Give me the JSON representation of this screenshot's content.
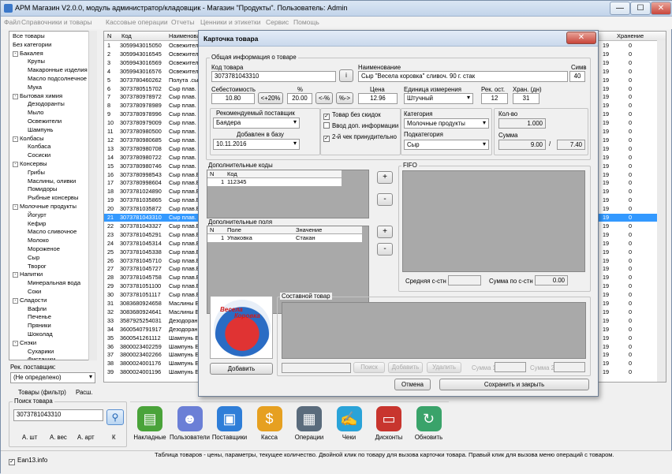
{
  "window": {
    "title": "АРМ Магазин V2.0.0, модуль администратор/кладовщик - Магазин \"Продукты\". Пользователь: Admin",
    "min": "—",
    "max": "☐",
    "close": "✕"
  },
  "menu": [
    "Файл",
    "Справочники и товары",
    "Кассовые операции",
    "Отчеты",
    "Ценники и этикетки",
    "Сервис",
    "Помощь"
  ],
  "tree": [
    {
      "label": "Все товары",
      "lvl": 0,
      "exp": ""
    },
    {
      "label": "Без категории",
      "lvl": 0,
      "exp": ""
    },
    {
      "label": "Бакалея",
      "lvl": 0,
      "exp": "-"
    },
    {
      "label": "Крупы",
      "lvl": 1,
      "exp": ""
    },
    {
      "label": "Макаронные изделия",
      "lvl": 1,
      "exp": ""
    },
    {
      "label": "Масло подсолнечное",
      "lvl": 1,
      "exp": ""
    },
    {
      "label": "Мука",
      "lvl": 1,
      "exp": ""
    },
    {
      "label": "Бытовая химия",
      "lvl": 0,
      "exp": "-"
    },
    {
      "label": "Дезодоранты",
      "lvl": 1,
      "exp": ""
    },
    {
      "label": "Мыло",
      "lvl": 1,
      "exp": ""
    },
    {
      "label": "Освежители",
      "lvl": 1,
      "exp": ""
    },
    {
      "label": "Шампунь",
      "lvl": 1,
      "exp": ""
    },
    {
      "label": "Колбасы",
      "lvl": 0,
      "exp": "-"
    },
    {
      "label": "Колбаса",
      "lvl": 1,
      "exp": ""
    },
    {
      "label": "Сосиски",
      "lvl": 1,
      "exp": ""
    },
    {
      "label": "Консервы",
      "lvl": 0,
      "exp": "-"
    },
    {
      "label": "Грибы",
      "lvl": 1,
      "exp": ""
    },
    {
      "label": "Маслины, оливки",
      "lvl": 1,
      "exp": ""
    },
    {
      "label": "Помидоры",
      "lvl": 1,
      "exp": ""
    },
    {
      "label": "Рыбные консервы",
      "lvl": 1,
      "exp": ""
    },
    {
      "label": "Молочные продукты",
      "lvl": 0,
      "exp": "-"
    },
    {
      "label": "Йогурт",
      "lvl": 1,
      "exp": ""
    },
    {
      "label": "Кефир",
      "lvl": 1,
      "exp": ""
    },
    {
      "label": "Масло сливочное",
      "lvl": 1,
      "exp": ""
    },
    {
      "label": "Молоко",
      "lvl": 1,
      "exp": ""
    },
    {
      "label": "Мороженое",
      "lvl": 1,
      "exp": ""
    },
    {
      "label": "Сыр",
      "lvl": 1,
      "exp": ""
    },
    {
      "label": "Творог",
      "lvl": 1,
      "exp": ""
    },
    {
      "label": "Напитки",
      "lvl": 0,
      "exp": "-"
    },
    {
      "label": "Минеральная вода",
      "lvl": 1,
      "exp": ""
    },
    {
      "label": "Соки",
      "lvl": 1,
      "exp": ""
    },
    {
      "label": "Сладости",
      "lvl": 0,
      "exp": "-"
    },
    {
      "label": "Вафли",
      "lvl": 1,
      "exp": ""
    },
    {
      "label": "Печенье",
      "lvl": 1,
      "exp": ""
    },
    {
      "label": "Пряники",
      "lvl": 1,
      "exp": ""
    },
    {
      "label": "Шоколад",
      "lvl": 1,
      "exp": ""
    },
    {
      "label": "Снэки",
      "lvl": 0,
      "exp": "-"
    },
    {
      "label": "Сухарики",
      "lvl": 1,
      "exp": ""
    },
    {
      "label": "Фисташки",
      "lvl": 1,
      "exp": ""
    }
  ],
  "left": {
    "supplier_label": "Рек. поставщик:",
    "supplier_value": "(Не определено)",
    "tab1": "Товары (фильтр)",
    "tab2": "Расш.",
    "search_group": "Поиск товара",
    "search_value": "3073781043310",
    "opt1": "А. шт",
    "opt2": "А. вес",
    "opt3": "А. арт",
    "opt4": "К",
    "ean": "Ean13.info"
  },
  "grid": {
    "headers": {
      "n": "N",
      "code": "Код",
      "name": "Наименование",
      "storage": "Хранение"
    },
    "rows": [
      {
        "n": "1",
        "code": "3059943015050",
        "name": "Освежител",
        "a": "19",
        "b": "0"
      },
      {
        "n": "2",
        "code": "3059943016545",
        "name": "Освежител",
        "a": "19",
        "b": "0"
      },
      {
        "n": "3",
        "code": "3059943016569",
        "name": "Освежител",
        "a": "19",
        "b": "0"
      },
      {
        "n": "4",
        "code": "3059943016576",
        "name": "Освежител",
        "a": "19",
        "b": "0"
      },
      {
        "n": "5",
        "code": "3073780460262",
        "name": "Полута .сы",
        "a": "19",
        "b": "0"
      },
      {
        "n": "6",
        "code": "3073780515702",
        "name": "Сыр плав.",
        "a": "19",
        "b": "0"
      },
      {
        "n": "7",
        "code": "3073780978972",
        "name": "Сыр плав.",
        "a": "19",
        "b": "0"
      },
      {
        "n": "8",
        "code": "3073780978989",
        "name": "Сыр плав.",
        "a": "19",
        "b": "0"
      },
      {
        "n": "9",
        "code": "3073780978996",
        "name": "Сыр плав.",
        "a": "19",
        "b": "0"
      },
      {
        "n": "10",
        "code": "3073780979009",
        "name": "Сыр плав.",
        "a": "19",
        "b": "0"
      },
      {
        "n": "11",
        "code": "3073780980500",
        "name": "Сыр плав.",
        "a": "19",
        "b": "0"
      },
      {
        "n": "12",
        "code": "3073780980685",
        "name": "Сыр плав.",
        "a": "19",
        "b": "0"
      },
      {
        "n": "13",
        "code": "3073780980708",
        "name": "Сыр плав.",
        "a": "19",
        "b": "0"
      },
      {
        "n": "14",
        "code": "3073780980722",
        "name": "Сыр плав.",
        "a": "19",
        "b": "0"
      },
      {
        "n": "15",
        "code": "3073780980746",
        "name": "Сыр плав.",
        "a": "19",
        "b": "0"
      },
      {
        "n": "16",
        "code": "3073780998543",
        "name": "Сыр плав.Е",
        "a": "19",
        "b": "0"
      },
      {
        "n": "17",
        "code": "3073780998604",
        "name": "Сыр плав.Е",
        "a": "19",
        "b": "0"
      },
      {
        "n": "18",
        "code": "3073781024890",
        "name": "Сыр плав.Е",
        "a": "19",
        "b": "0"
      },
      {
        "n": "19",
        "code": "3073781035865",
        "name": "Сыр плав.Е",
        "a": "19",
        "b": "0"
      },
      {
        "n": "20",
        "code": "3073781035872",
        "name": "Сыр плав.Е",
        "a": "19",
        "b": "0"
      },
      {
        "n": "21",
        "code": "3073781043310",
        "name": "Сыр плав.",
        "a": "19",
        "b": "0",
        "sel": true
      },
      {
        "n": "22",
        "code": "3073781043327",
        "name": "Сыр плав.Е",
        "a": "19",
        "b": "0"
      },
      {
        "n": "23",
        "code": "3073781045291",
        "name": "Сыр плав.Е",
        "a": "19",
        "b": "0"
      },
      {
        "n": "24",
        "code": "3073781045314",
        "name": "Сыр плав.Е",
        "a": "19",
        "b": "0"
      },
      {
        "n": "25",
        "code": "3073781045338",
        "name": "Сыр плав.Е",
        "a": "19",
        "b": "0"
      },
      {
        "n": "26",
        "code": "3073781045710",
        "name": "Сыр плав.Е",
        "a": "19",
        "b": "0"
      },
      {
        "n": "27",
        "code": "3073781045727",
        "name": "Сыр плав.Е",
        "a": "19",
        "b": "0"
      },
      {
        "n": "28",
        "code": "3073781045758",
        "name": "Сыр плав.Е",
        "a": "19",
        "b": "0"
      },
      {
        "n": "29",
        "code": "3073781051100",
        "name": "Сыр плав.Е",
        "a": "19",
        "b": "0"
      },
      {
        "n": "30",
        "code": "3073781051117",
        "name": "Сыр плав.Е",
        "a": "19",
        "b": "0"
      },
      {
        "n": "31",
        "code": "3083680924658",
        "name": "Маслины Б",
        "a": "19",
        "b": "0"
      },
      {
        "n": "32",
        "code": "3083680924641",
        "name": "Маслины Б",
        "a": "19",
        "b": "0"
      },
      {
        "n": "33",
        "code": "3587925254031",
        "name": "Дезодоран",
        "a": "19",
        "b": "0"
      },
      {
        "n": "34",
        "code": "3600540791917",
        "name": "Дезодоран",
        "a": "19",
        "b": "0"
      },
      {
        "n": "35",
        "code": "3600541261112",
        "name": "Шампунь E",
        "a": "19",
        "b": "0"
      },
      {
        "n": "36",
        "code": "3800023402259",
        "name": "Шампунь E",
        "a": "19",
        "b": "0"
      },
      {
        "n": "37",
        "code": "3800023402266",
        "name": "Шампунь E",
        "a": "19",
        "b": "0"
      },
      {
        "n": "38",
        "code": "3800024001176",
        "name": "Шампунь E",
        "a": "19",
        "b": "0"
      },
      {
        "n": "39",
        "code": "3800024001196",
        "name": "Шампунь E",
        "a": "19",
        "b": "0"
      }
    ]
  },
  "toolbar": [
    {
      "label": "Накладные",
      "color": "#4aa33a",
      "icon": "invoices-icon",
      "glyph": "▤"
    },
    {
      "label": "Пользователи",
      "color": "#6b7fd6",
      "icon": "users-icon",
      "glyph": "☻"
    },
    {
      "label": "Поставщики",
      "color": "#2f7ed8",
      "icon": "suppliers-icon",
      "glyph": "▣"
    },
    {
      "label": "Касса",
      "color": "#e6a021",
      "icon": "cash-icon",
      "glyph": "$"
    },
    {
      "label": "Операции",
      "color": "#5a6b7c",
      "icon": "operations-icon",
      "glyph": "▦"
    },
    {
      "label": "Чеки",
      "color": "#2aa3d8",
      "icon": "receipts-icon",
      "glyph": "✍"
    },
    {
      "label": "Дисконты",
      "color": "#c8352e",
      "icon": "discounts-icon",
      "glyph": "▭"
    },
    {
      "label": "Обновить",
      "color": "#3aa36a",
      "icon": "refresh-icon",
      "glyph": "↻"
    }
  ],
  "status_text": "Таблица товаров - цены, параметры, текущее количество. Двойной клик по товару для вызова карточки товара. Правый клик для вызова меню операций с товаром.",
  "dialog": {
    "title": "Карточка товара",
    "close": "✕",
    "general_group": "Общая информация  о товаре",
    "code_label": "Код товара",
    "code_value": "3073781043310",
    "info_btn": "i",
    "name_label": "Наименование",
    "name_value": "Сыр \"Весела коровка\" сливоч. 90 г. стак",
    "sym_label": "Симв",
    "sym_value": "40",
    "cost_label": "Себестоимость",
    "cost_value": "10.80",
    "plus20": "<+20%",
    "pct_label": "%",
    "pct_value": "20.00",
    "lt_pct": "<-%",
    "pct_gt": "%->",
    "price_label": "Цена",
    "price_value": "12.96",
    "unit_label": "Единица измерения",
    "unit_value": "Штучный",
    "rest_label": "Рек. ост.",
    "rest_value": "12",
    "store_label": "Хран. (дн)",
    "store_value": "31",
    "rec_supplier_label": "Рекомендуемый поставщик",
    "rec_supplier_value": "Баядера",
    "added_label": "Добавлен в базу",
    "added_value": "10.11.2016",
    "chk_nodisc": "Товар без скидок",
    "chk_extra": "Ввод доп. информации",
    "chk_second": "2-й чек принудительно",
    "cat_label": "Категория",
    "cat_value": "Молочные продукты",
    "subcat_label": "Подкатегория",
    "subcat_value": "Сыр",
    "qty_label": "Кол-во",
    "qty_value": "1.000",
    "sum_label": "Сумма",
    "sum_value1": "9.00",
    "sum_sep": "/",
    "sum_value2": "7.40",
    "addcodes_label": "Дополнительные коды",
    "addcodes_headers": [
      "N",
      "Код"
    ],
    "addcodes_rows": [
      [
        "1",
        "112345"
      ]
    ],
    "addfields_label": "Дополнительные поля",
    "addfields_headers": [
      "N",
      "Поле",
      "Значение"
    ],
    "addfields_rows": [
      [
        "1",
        "Упаковка",
        "Стакан"
      ]
    ],
    "plus": "+",
    "minus": "-",
    "fifo_label": "FIFO",
    "avg_label": "Средняя с-стн",
    "sumcost_label": "Сумма по с-стн",
    "sumcost_value": "0.00",
    "composite_label": "Составной товар",
    "image_add": "Добавить",
    "logo_line1": "Весела",
    "logo_line2": "Коровка",
    "search_btn": "Поиск",
    "add_btn": "Добавить",
    "del_btn": "Удалить",
    "sum1_label": "Сумма 1",
    "sum2_label": "Сумма 2",
    "cancel_btn": "Отмена",
    "save_btn": "Сохранить и закрыть"
  }
}
